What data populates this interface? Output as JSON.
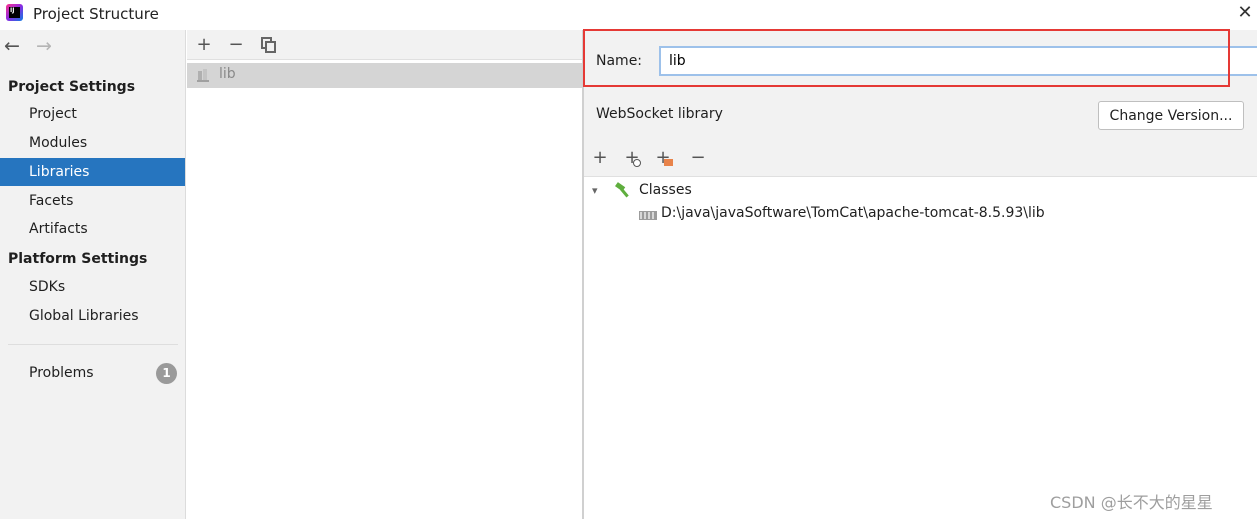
{
  "window": {
    "title": "Project Structure",
    "close_glyph": "✕"
  },
  "sidebar": {
    "back_glyph": "←",
    "forward_glyph": "→",
    "project_settings_header": "Project Settings",
    "project_settings_items": [
      {
        "label": "Project",
        "selected": false
      },
      {
        "label": "Modules",
        "selected": false
      },
      {
        "label": "Libraries",
        "selected": true
      },
      {
        "label": "Facets",
        "selected": false
      },
      {
        "label": "Artifacts",
        "selected": false
      }
    ],
    "platform_settings_header": "Platform Settings",
    "platform_settings_items": [
      {
        "label": "SDKs"
      },
      {
        "label": "Global Libraries"
      }
    ],
    "problems": {
      "label": "Problems",
      "count": "1"
    }
  },
  "middle": {
    "add_glyph": "+",
    "remove_glyph": "−",
    "libraries": [
      {
        "label": "lib"
      }
    ]
  },
  "detail": {
    "name_label": "Name:",
    "name_value": "lib",
    "library_type": "WebSocket library",
    "change_version_label": "Change Version...",
    "add_glyph": "+",
    "remove_glyph": "−",
    "tree": {
      "root_label": "Classes",
      "children": [
        {
          "label": "D:\\java\\javaSoftware\\TomCat\\apache-tomcat-8.5.93\\lib"
        }
      ]
    }
  },
  "colors": {
    "selection": "#2675bf",
    "highlight_box": "#e53935",
    "input_border": "#9dc1ea"
  },
  "icons": {
    "classes": "hammer-icon",
    "path": "jar-folder-icon",
    "library": "library-icon"
  },
  "watermark": "CSDN @长不大的星星"
}
